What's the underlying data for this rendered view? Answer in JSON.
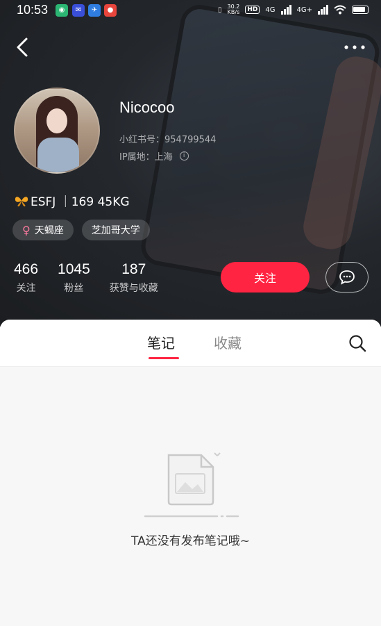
{
  "status_bar": {
    "time": "10:53",
    "net_speed_value": "30.2",
    "net_speed_unit": "KB/s",
    "hd_label": "HD",
    "network_1": "4G",
    "network_2": "4G+"
  },
  "nav": {
    "back_icon": "chevron-left-icon",
    "more_icon": "more-dots-icon"
  },
  "profile": {
    "name": "Nicocoo",
    "red_id": "小红书号：954799544",
    "ip_location": "IP属地：上海",
    "bio": "ESFJ ｜169 45KG",
    "tags": [
      {
        "label": "天蝎座",
        "icon": "female-icon"
      },
      {
        "label": "芝加哥大学"
      }
    ],
    "stats": [
      {
        "value": "466",
        "label": "关注"
      },
      {
        "value": "1045",
        "label": "粉丝"
      },
      {
        "value": "187",
        "label": "获赞与收藏"
      }
    ],
    "follow_label": "关注",
    "accent_color": "#ff2442"
  },
  "tabs": [
    {
      "label": "笔记",
      "active": true
    },
    {
      "label": "收藏",
      "active": false
    }
  ],
  "empty_state": {
    "message": "TA还没有发布笔记哦~"
  }
}
